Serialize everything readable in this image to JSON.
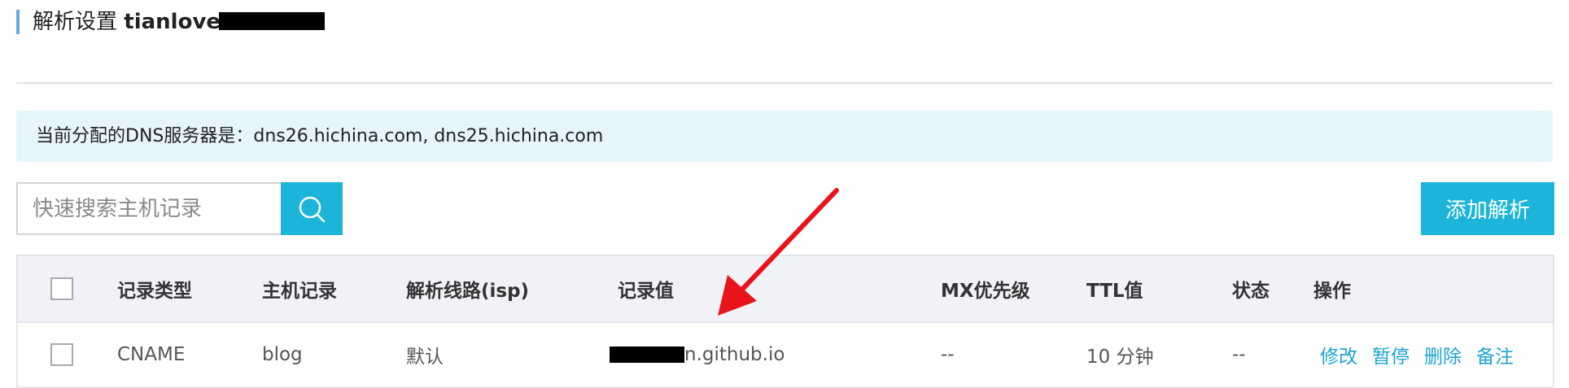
{
  "header": {
    "title_prefix": "解析设置",
    "domain_visible": "tianlove"
  },
  "dns_notice": {
    "text": "当前分配的DNS服务器是：dns26.hichina.com, dns25.hichina.com"
  },
  "search": {
    "placeholder": "快速搜索主机记录",
    "button_icon": "search-icon"
  },
  "add_button": {
    "label": "添加解析"
  },
  "table": {
    "columns": [
      "记录类型",
      "主机记录",
      "解析线路(isp)",
      "记录值",
      "MX优先级",
      "TTL值",
      "状态",
      "操作"
    ],
    "rows": [
      {
        "type": "CNAME",
        "host": "blog",
        "line": "默认",
        "value_visible": "n.github.io",
        "mx": "--",
        "ttl": "10 分钟",
        "status": "--",
        "actions": [
          "修改",
          "暂停",
          "删除",
          "备注"
        ]
      }
    ]
  },
  "colors": {
    "accent": "#1cb5d9",
    "notice_bg": "#e6f4fc",
    "link": "#1ca3d6",
    "arrow": "#e8141a"
  }
}
